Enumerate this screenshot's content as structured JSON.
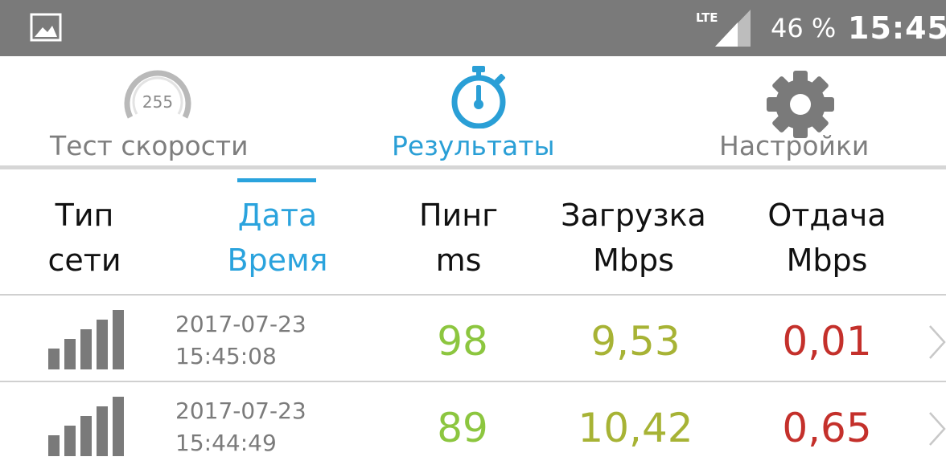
{
  "status_bar": {
    "network_label": "LTE",
    "battery": "46 %",
    "clock": "15:45"
  },
  "tabs": [
    {
      "label": "Тест скорости",
      "icon": "speedometer-icon",
      "active": false
    },
    {
      "label": "Результаты",
      "icon": "stopwatch-icon",
      "active": true
    },
    {
      "label": "Настройки",
      "icon": "gear-icon",
      "active": false
    }
  ],
  "columns": {
    "type": {
      "line1": "Тип",
      "line2": "сети"
    },
    "date": {
      "line1": "Дата",
      "line2": "Время"
    },
    "ping": {
      "line1": "Пинг",
      "line2": "ms"
    },
    "download": {
      "line1": "Загрузка",
      "line2": "Mbps"
    },
    "upload": {
      "line1": "Отдача",
      "line2": "Mbps"
    }
  },
  "speedometer_text": "255",
  "results": [
    {
      "network_icon": "signal-bars-icon",
      "date": "2017-07-23",
      "time": "15:45:08",
      "ping": "98",
      "download": "9,53",
      "upload": "0,01"
    },
    {
      "network_icon": "signal-bars-icon",
      "date": "2017-07-23",
      "time": "15:44:49",
      "ping": "89",
      "download": "10,42",
      "upload": "0,65"
    }
  ],
  "colors": {
    "status_bar": "#7a7a7a",
    "accent": "#2aa3dd",
    "ping": "#8cc63f",
    "download": "#a7b335",
    "upload": "#c4302b"
  }
}
